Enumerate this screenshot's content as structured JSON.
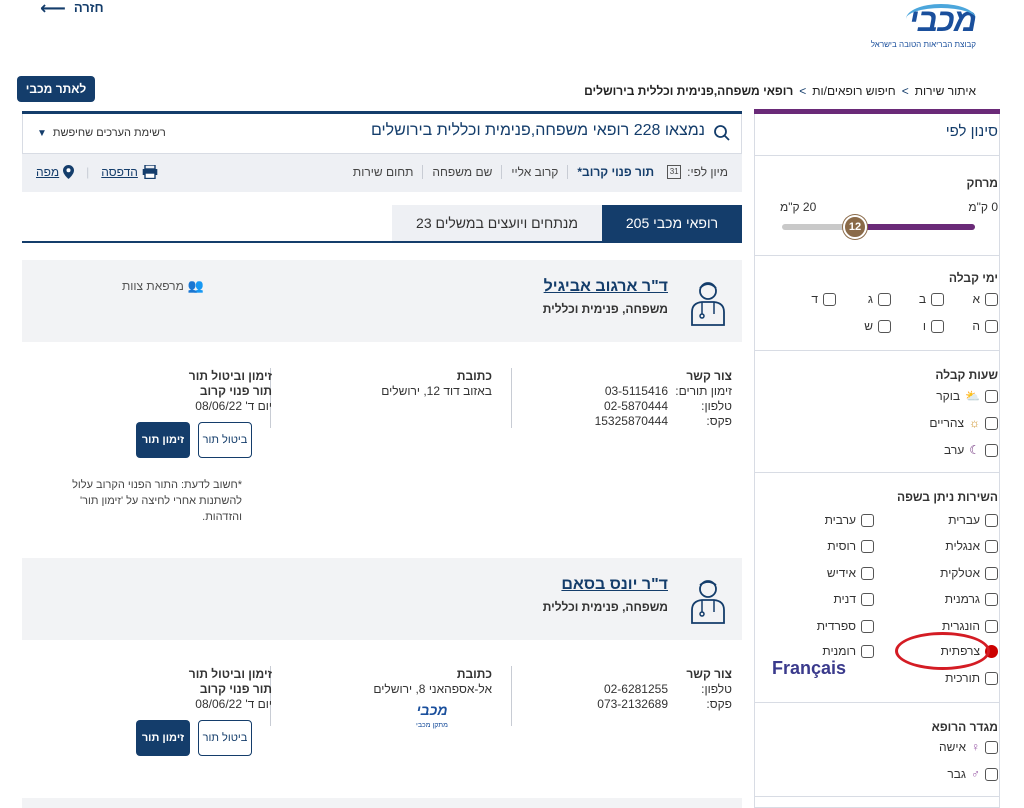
{
  "header": {
    "back_label": "חזרה",
    "logo_text": "מכבי",
    "logo_sub": "קבוצת הבריאות הטובה בישראל",
    "site_button": "לאתר מכבי",
    "breadcrumb": [
      "איתור שירות",
      "חיפוש רופאים/ות",
      "רופאי משפחה,פנימית וכללית בירושלים"
    ]
  },
  "results": {
    "title": "נמצאו 228 רופאי משפחה,פנימית וכללית בירושלים",
    "saved_list": "רשימת הערכים שחיפשת"
  },
  "sort": {
    "label": "מיון לפי:",
    "options": [
      "תור פנוי קרוב*",
      "קרוב אליי",
      "שם משפחה",
      "תחום שירות"
    ],
    "print": "הדפסה",
    "map": "מפה"
  },
  "tabs": {
    "active": "205 רופאי מכבי",
    "inactive": "23 מנתחים ויועצים במשלים"
  },
  "doctors": [
    {
      "name": "ד\"ר ארגוב אביגיל",
      "specialty": "משפחה, פנימית וכללית",
      "team": "מרפאת צוות",
      "contact_title": "צור קשר",
      "contact_rows": [
        [
          "זימון תורים:",
          "03-5115416"
        ],
        [
          "טלפון:",
          "02-5870444"
        ],
        [
          "פקס:",
          "15325870444"
        ]
      ],
      "address_title": "כתובת",
      "address": "באזוב דוד 12, ירושלים",
      "appt_title": "זימון וביטול תור",
      "appt_sub": "תור פנוי קרוב",
      "appt_date": "יום ד' 08/06/22",
      "cancel_label": "ביטול תור",
      "book_label": "זימון תור",
      "note": "*חשוב לדעת: התור הפנוי הקרוב עלול להשתנות אחרי לחיצה על 'זימון תור' והזדהות."
    },
    {
      "name": "ד\"ר יונס בסאם",
      "specialty": "משפחה, פנימית וכללית",
      "contact_title": "צור קשר",
      "contact_rows": [
        [
          "טלפון:",
          "02-6281255"
        ],
        [
          "פקס:",
          "073-2132689"
        ]
      ],
      "address_title": "כתובת",
      "address": "אל-אספהאני 8, ירושלים",
      "clinic_logo": "מכבי",
      "clinic_sub": "מתקן מכבי",
      "appt_title": "זימון וביטול תור",
      "appt_sub": "תור פנוי קרוב",
      "appt_date": "יום ד' 08/06/22",
      "cancel_label": "ביטול תור",
      "book_label": "זימון תור"
    }
  ],
  "sidebar": {
    "title": "סינון לפי",
    "distance": {
      "title": "מרחק",
      "min_label": "0 ק\"מ",
      "max_label": "20 ק\"מ",
      "value": "12"
    },
    "days": {
      "title": "ימי קבלה",
      "items": [
        "א",
        "ב",
        "ג",
        "ד",
        "ה",
        "ו",
        "ש"
      ]
    },
    "hours": {
      "title": "שעות קבלה",
      "items": [
        "בוקר",
        "צהריים",
        "ערב"
      ]
    },
    "languages": {
      "title": "השירות ניתן בשפה",
      "right": [
        "עברית",
        "אנגלית",
        "אטלקית",
        "גרמנית",
        "הונגרית",
        "צרפתית",
        "תורכית"
      ],
      "left": [
        "ערבית",
        "רוסית",
        "אידיש",
        "דנית",
        "ספרדית",
        "רומנית"
      ]
    },
    "gender": {
      "title": "מגדר הרופא",
      "items": [
        "אישה",
        "גבר"
      ]
    }
  },
  "annotation": {
    "label": "Français"
  },
  "colors": {
    "navy": "#143d6b",
    "purple": "#6a2a78",
    "annotation_red": "#d41c24"
  }
}
